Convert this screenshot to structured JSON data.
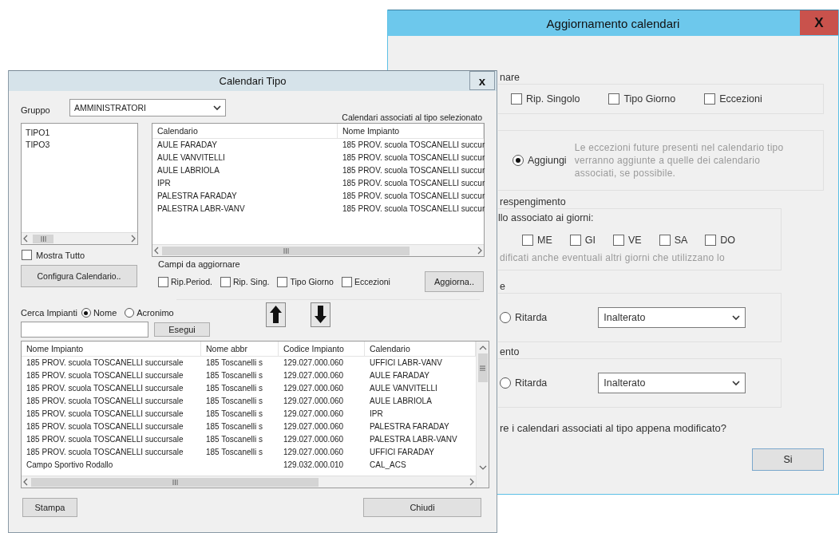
{
  "back_dialog": {
    "title": "Aggiornamento calendari",
    "close": "X",
    "fields_group": {
      "legend": "nare",
      "checkboxes": [
        {
          "label": "Rip. Singolo",
          "checked": false
        },
        {
          "label": "Tipo Giorno",
          "checked": false
        },
        {
          "label": "Eccezioni",
          "checked": false
        }
      ]
    },
    "exceptions_group": {
      "option": {
        "label": "Aggiungi",
        "selected": true
      },
      "note": "Le eccezioni future presenti nel calendario tipo verranno aggiunte a quelle dei calendario associati, se possibile."
    },
    "bounce_group": {
      "legend": "respengimento",
      "prompt": "llo associato ai giorni:",
      "days": [
        {
          "label": "ME",
          "checked": false
        },
        {
          "label": "GI",
          "checked": false
        },
        {
          "label": "VE",
          "checked": false
        },
        {
          "label": "SA",
          "checked": false
        },
        {
          "label": "DO",
          "checked": false
        }
      ],
      "note": "dificati anche eventuali altri giorni che utilizzano lo"
    },
    "shift_groups": [
      {
        "legend": "e",
        "option": {
          "label": "Ritarda",
          "selected": false
        },
        "dropdown": "Inalterato"
      },
      {
        "legend": "ento",
        "option": {
          "label": "Ritarda",
          "selected": false
        },
        "dropdown": "Inalterato"
      }
    ],
    "question": "re i calendari associati al tipo appena modificato?",
    "buttons": [
      "Si"
    ]
  },
  "front_dialog": {
    "title": "Calendari Tipo",
    "close": "x",
    "group_label": "Gruppo",
    "group_value": "AMMINISTRATORI",
    "associated_caption": "Calendari associati al tipo selezionato",
    "types": [
      {
        "label": "TIPO1",
        "selected": false
      },
      {
        "label": "TIPO3",
        "selected": false
      }
    ],
    "show_all": {
      "label": "Mostra Tutto",
      "checked": false
    },
    "configure_button": "Configura Calendario..",
    "associated_table": {
      "columns": [
        "Calendario",
        "Nome Impianto"
      ],
      "rows": [
        [
          "AULE FARADAY",
          "185 PROV. scuola TOSCANELLI succur"
        ],
        [
          "AULE VANVITELLI",
          "185 PROV. scuola TOSCANELLI succur"
        ],
        [
          "AULE LABRIOLA",
          "185 PROV. scuola TOSCANELLI succur"
        ],
        [
          "IPR",
          "185 PROV. scuola TOSCANELLI succur"
        ],
        [
          "PALESTRA FARADAY",
          "185 PROV. scuola TOSCANELLI succur"
        ],
        [
          "PALESTRA LABR-VANV",
          "185 PROV. scuola TOSCANELLI succur"
        ]
      ]
    },
    "update_fields": {
      "label": "Campi da aggiornare",
      "checkboxes": [
        {
          "label": "Rip.Period.",
          "checked": false
        },
        {
          "label": "Rip. Sing.",
          "checked": false
        },
        {
          "label": "Tipo Giorno",
          "checked": false
        },
        {
          "label": "Eccezioni",
          "checked": false
        }
      ],
      "button": "Aggiorna.."
    },
    "search": {
      "label": "Cerca Impianti",
      "options": [
        {
          "label": "Nome",
          "selected": true
        },
        {
          "label": "Acronimo",
          "selected": false
        }
      ],
      "button": "Esegui"
    },
    "plants_table": {
      "columns": [
        "Nome Impianto",
        "Nome abbr",
        "Codice Impianto",
        "Calendario"
      ],
      "rows": [
        [
          "185 PROV. scuola TOSCANELLI succursale",
          "185 Toscanelli s",
          "129.027.000.060",
          "UFFICI LABR-VANV"
        ],
        [
          "185 PROV. scuola TOSCANELLI succursale",
          "185 Toscanelli s",
          "129.027.000.060",
          "AULE FARADAY"
        ],
        [
          "185 PROV. scuola TOSCANELLI succursale",
          "185 Toscanelli s",
          "129.027.000.060",
          "AULE VANVITELLI"
        ],
        [
          "185 PROV. scuola TOSCANELLI succursale",
          "185 Toscanelli s",
          "129.027.000.060",
          "AULE LABRIOLA"
        ],
        [
          "185 PROV. scuola TOSCANELLI succursale",
          "185 Toscanelli s",
          "129.027.000.060",
          "IPR"
        ],
        [
          "185 PROV. scuola TOSCANELLI succursale",
          "185 Toscanelli s",
          "129.027.000.060",
          "PALESTRA FARADAY"
        ],
        [
          "185 PROV. scuola TOSCANELLI succursale",
          "185 Toscanelli s",
          "129.027.000.060",
          "PALESTRA LABR-VANV"
        ],
        [
          "185 PROV. scuola TOSCANELLI succursale",
          "185 Toscanelli s",
          "129.027.000.060",
          "UFFICI FARADAY"
        ],
        [
          "Campo Sportivo Rodallo",
          "",
          "129.032.000.010",
          "CAL_ACS"
        ]
      ]
    },
    "buttons": [
      "Stampa",
      "Chiudi"
    ]
  }
}
